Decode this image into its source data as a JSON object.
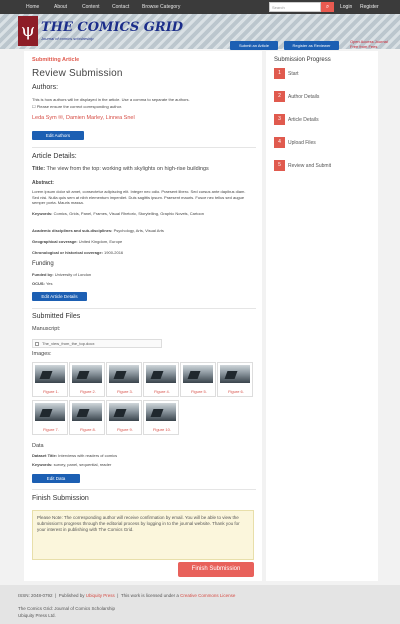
{
  "nav": {
    "items": [
      "Home",
      "About",
      "Content",
      "Contact",
      "Browse Category"
    ],
    "search_placeholder": "Search",
    "login": "Login",
    "register": "Register"
  },
  "header": {
    "logo_letter": "ψ",
    "title": "THE COMICS GRID",
    "subtitle": "Journal of comics scholarship",
    "btn_submit": "Submit an Article",
    "btn_register": "Register as Reviewer",
    "note": "Open Access Journal Free from Fees"
  },
  "main": {
    "crumb": "Submitting Article",
    "title": "Review Submission",
    "authors_heading": "Authors:",
    "authors_note1": "This is how authors will be displayed in the article. Use a comma to separate the authors.",
    "authors_note2": "Please ensure the correct corresponding author.",
    "author1": "Leda Sym",
    "author2": "Damien Marley",
    "author3": "Linnea Snel",
    "edit_authors": "Edit Authors",
    "details_heading": "Article Details:",
    "title_label": "Title:",
    "title_value": "The view from the top: working with skylights on high-rise buildings",
    "abstract_label": "Abstract:",
    "abstract_text": "Lorem ipsum dolor sit amet, consectetur adipiscing elit. Integer nec odio. Praesent libero. Sed cursus ante dapibus diam. Sed nisi. Nulla quis sem at nibh elementum imperdiet. Duis sagittis ipsum. Praesent mauris. Fusce nec tellus sed augue semper porta. Mauris massa.",
    "keywords_label": "Keywords:",
    "keywords_text": "Comics, Grids, Panel, Frames, Visual Rhetoric, Storytelling, Graphic Novels, Cartoon",
    "disciplines_label": "Academic disciplines and sub-disciplines:",
    "disciplines_text": "Psychology, Arts, Visual Arts",
    "geo_label": "Geographical coverage:",
    "geo_text": "United Kingdom, Europe",
    "chrono_label": "Chronological or historical coverage:",
    "chrono_text": "1900-2016",
    "funding_heading": "Funding",
    "funded_label": "Funded by:",
    "funded_text": "University of London",
    "grant_label": "OCUS:",
    "grant_text": "Yes",
    "edit_details": "Edit Article Details",
    "files_heading": "Submitted Files",
    "manuscript_label": "Manuscript:",
    "manuscript_file": "The_view_from_the_top.docx",
    "images_label": "Images:",
    "figures": [
      "Figure 1.",
      "Figure 2.",
      "Figure 3.",
      "Figure 4.",
      "Figure 5.",
      "Figure 6.",
      "Figure 7.",
      "Figure 8.",
      "Figure 9.",
      "Figure 10."
    ],
    "data_label": "Data",
    "dataset_label": "Dataset Title:",
    "dataset_text": "Interviews with readers of comics",
    "data_keywords_label": "Keywords:",
    "data_keywords_text": "survey, panel, sequential, reader",
    "edit_data": "Edit Data",
    "finish_heading": "Finish Submission",
    "finish_note": "Please Note: The corresponding author will receive confirmation by email. You will be able to view the submission's progress through the editorial process by logging in to the journal website. Thank you for your interest in publishing with The Comics Grid.",
    "finish_button": "Finish Submission"
  },
  "sidebar": {
    "title": "Submission Progress",
    "steps": [
      {
        "num": "1",
        "label": "Start"
      },
      {
        "num": "2",
        "label": "Author Details"
      },
      {
        "num": "3",
        "label": "Article Details"
      },
      {
        "num": "4",
        "label": "Upload Files"
      },
      {
        "num": "5",
        "label": "Review and Submit"
      }
    ]
  },
  "footer": {
    "issn": "ISSN: 2048-0792",
    "published_by": "Published by",
    "publisher": "Ubiquity Press",
    "license_text": "This work is licensed under a",
    "license": "Creative Commons License",
    "line2": "The Comics Grid: Journal of Comics Scholarship",
    "line3": "Ubiquity Press Ltd."
  },
  "colors": {
    "accent": "#e05a4e",
    "blue": "#1c5fb3"
  }
}
